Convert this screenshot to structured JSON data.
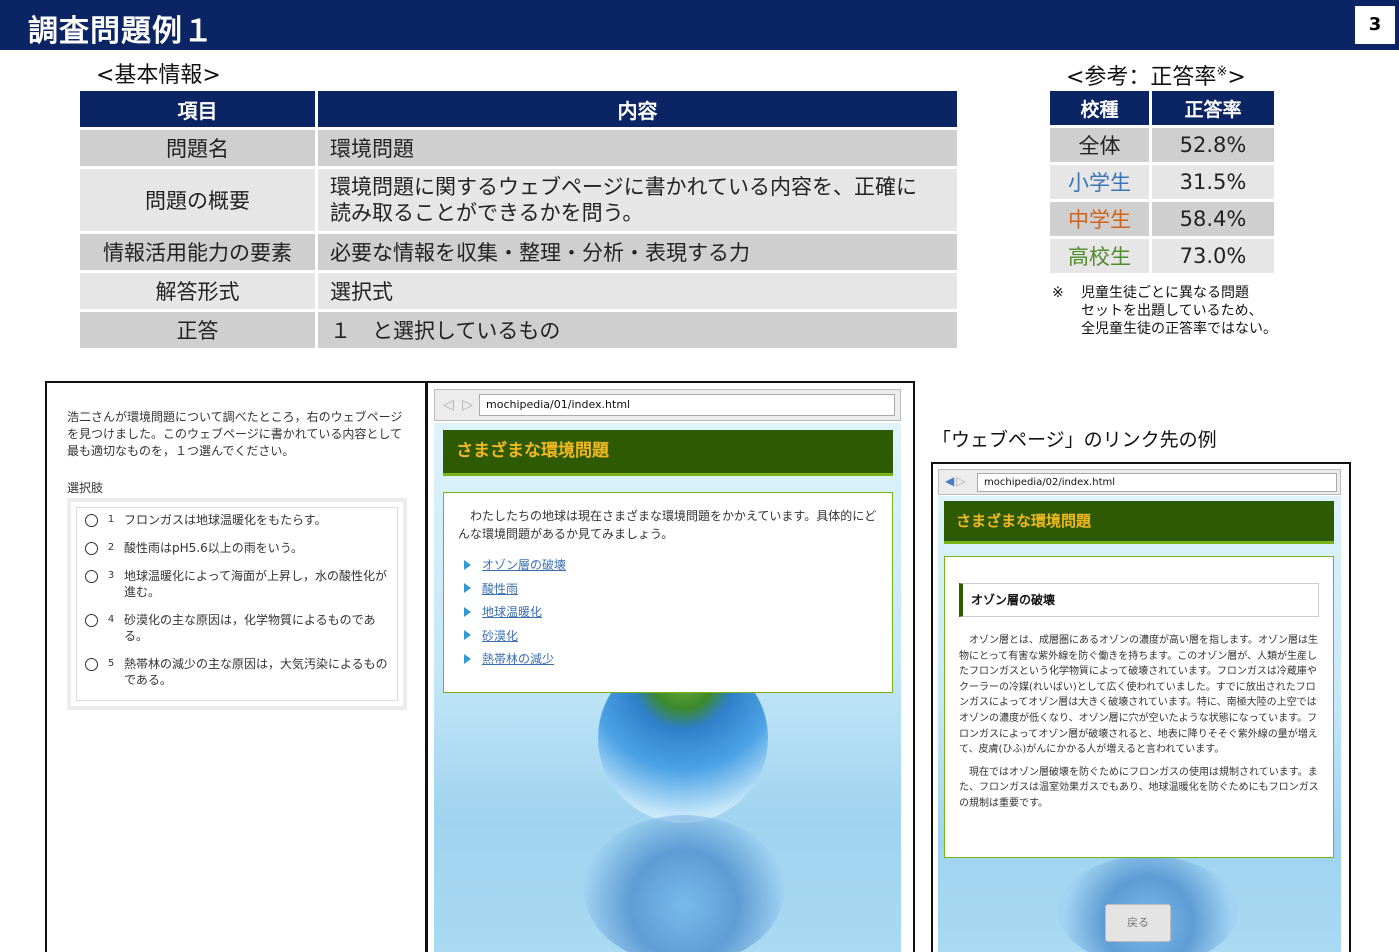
{
  "header": {
    "title": "調査問題例１",
    "page_number": "3"
  },
  "basic_info": {
    "label": "<基本情報>",
    "headers": [
      "項目",
      "内容"
    ],
    "rows": [
      [
        "問題名",
        "環境問題"
      ],
      [
        "問題の概要",
        "環境問題に関するウェブページに書かれている内容を、正確に",
        "読み取ることができるかを問う。"
      ],
      [
        "情報活用能力の要素",
        "必要な情報を収集・整理・分析・表現する力"
      ],
      [
        "解答形式",
        "選択式"
      ],
      [
        "正答",
        "１　と選択しているもの"
      ]
    ]
  },
  "reference": {
    "label_main": "<参考：正答率",
    "label_mark": "※",
    "label_end": ">",
    "headers": [
      "校種",
      "正答率"
    ],
    "rows": [
      {
        "type": "全体",
        "rate": "52.8%",
        "color": "#222222"
      },
      {
        "type": "小学生",
        "rate": "31.5%",
        "color": "#3a74b8"
      },
      {
        "type": "中学生",
        "rate": "58.4%",
        "color": "#d0621a"
      },
      {
        "type": "高校生",
        "rate": "73.0%",
        "color": "#4f8a2c"
      }
    ],
    "note_mark": "※",
    "note_lines": [
      "児童生徒ごとに異なる問題",
      "セットを出題しているため、",
      "全児童生徒の正答率ではない。"
    ]
  },
  "question": {
    "text": "浩二さんが環境問題について調べたところ，右のウェブページを見つけました。このウェブページに書かれている内容として最も適切なものを，１つ選んでください。",
    "choices_label": "選択肢",
    "choices": [
      {
        "num": "1",
        "text": "フロンガスは地球温暖化をもたらす。"
      },
      {
        "num": "2",
        "text": "酸性雨はpH5.6以上の雨をいう。"
      },
      {
        "num": "3",
        "text": "地球温暖化によって海面が上昇し，水の酸性化が進む。"
      },
      {
        "num": "4",
        "text": "砂漠化の主な原因は，化学物質によるものである。"
      },
      {
        "num": "5",
        "text": "熱帯林の減少の主な原因は，大気汚染によるものである。"
      }
    ]
  },
  "browser1": {
    "url": "mochipedia/01/index.html",
    "nav": "◁ ▷",
    "page_title": "さまざまな環境問題",
    "intro": "わたしたちの地球は現在さまざまな環境問題をかかえています。具体的にどんな環境問題があるか見てみましょう。",
    "links": [
      "オゾン層の破壊",
      "酸性雨",
      "地球温暖化",
      "砂漠化",
      "熱帯林の減少"
    ]
  },
  "browser2": {
    "caption": "「ウェブページ」のリンク先の例",
    "url": "mochipedia/02/index.html",
    "nav_back": "◀",
    "nav_forward": "▷",
    "page_title": "さまざまな環境問題",
    "subheading": "オゾン層の破壊",
    "para1": "オゾン層とは、成層圏にあるオゾンの濃度が高い層を指します。オゾン層は生物にとって有害な紫外線を防ぐ働きを持ちます。このオゾン層が、人類が生産したフロンガスという化学物質によって破壊されています。フロンガスは冷蔵庫やクーラーの冷媒(れいばい)として広く使われていました。すでに放出されたフロンガスによってオゾン層は大きく破壊されています。特に、南極大陸の上空ではオゾンの濃度が低くなり、オゾン層に穴が空いたような状態になっています。フロンガスによってオゾン層が破壊されると、地表に降りそそぐ紫外線の量が増えて、皮膚(ひふ)がんにかかる人が増えると言われています。",
    "para2": "現在ではオゾン層破壊を防ぐためにフロンガスの使用は規制されています。また、フロンガスは温室効果ガスでもあり、地球温暖化を防ぐためにもフロンガスの規制は重要です。",
    "back_button": "戻る"
  }
}
